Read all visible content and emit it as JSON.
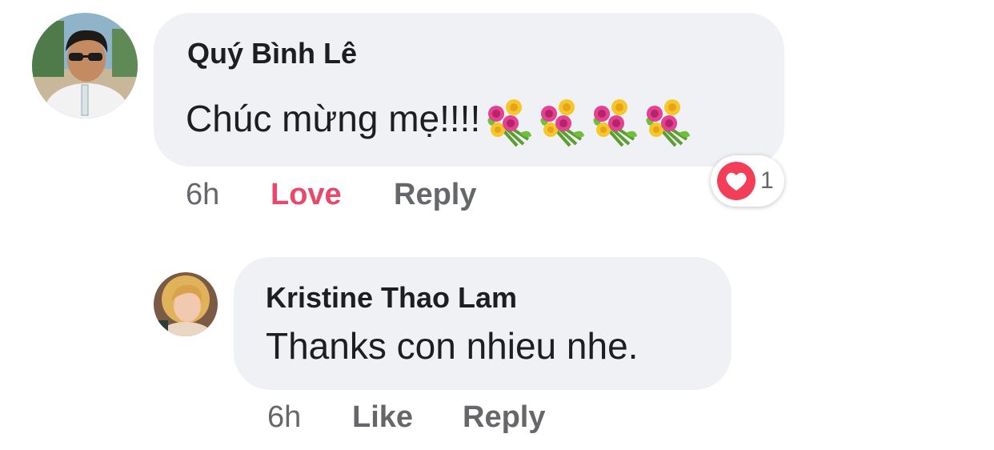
{
  "comments": [
    {
      "author": "Quý Bình Lê",
      "text": "Chúc mừng mẹ!!!!",
      "emoji_icons": [
        "bouquet-emoji",
        "bouquet-emoji",
        "bouquet-emoji",
        "bouquet-emoji"
      ],
      "time": "6h",
      "like_label": "Love",
      "reply_label": "Reply",
      "reaction": {
        "icon": "heart-reaction-icon",
        "count": "1",
        "color": "#f33e58"
      }
    },
    {
      "author": "Kristine Thao Lam",
      "text": "Thanks con nhieu nhe.",
      "time": "6h",
      "like_label": "Like",
      "reply_label": "Reply"
    }
  ],
  "colors": {
    "bubble": "#f0f1f4",
    "love_active": "#e9486a",
    "meta_text": "#65676b",
    "author_text": "#1c1e21"
  }
}
